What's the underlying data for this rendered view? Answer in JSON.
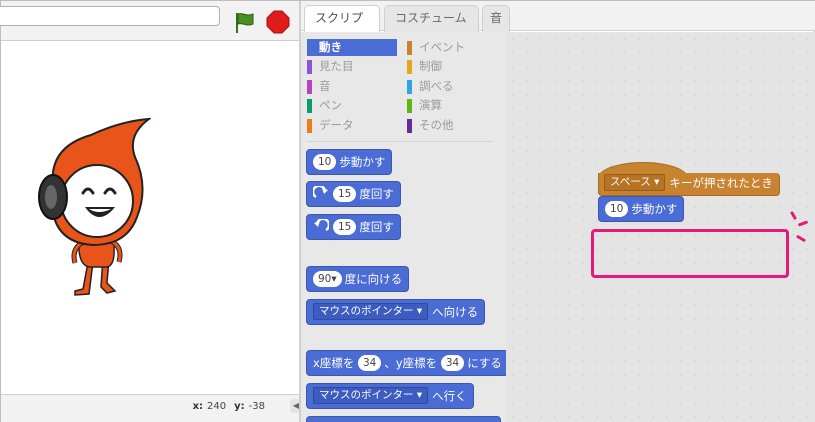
{
  "stage": {
    "coords": {
      "x_label": "x:",
      "x_value": "240",
      "y_label": "y:",
      "y_value": "-38"
    }
  },
  "tabs": [
    {
      "label": "スクリプト"
    },
    {
      "label": "コスチューム"
    },
    {
      "label": "音"
    }
  ],
  "categories": [
    {
      "label": "動き",
      "color": "#4a6cd4"
    },
    {
      "label": "イベント",
      "color": "#c88330"
    },
    {
      "label": "見た目",
      "color": "#8a55d7"
    },
    {
      "label": "制御",
      "color": "#e1a91a"
    },
    {
      "label": "音",
      "color": "#bb42c3"
    },
    {
      "label": "調べる",
      "color": "#2ca5e2"
    },
    {
      "label": "ペン",
      "color": "#0e9a6c"
    },
    {
      "label": "演算",
      "color": "#5cb712"
    },
    {
      "label": "データ",
      "color": "#ee7d16"
    },
    {
      "label": "その他",
      "color": "#632d99"
    }
  ],
  "palette": {
    "move": {
      "num": "10",
      "text": "歩動かす"
    },
    "turn_right": {
      "num": "15",
      "text": "度回す"
    },
    "turn_left": {
      "num": "15",
      "text": "度回す"
    },
    "point_dir": {
      "value": "90▾",
      "text": "度に向ける"
    },
    "point_towards": {
      "drop": "マウスのポインター ▾",
      "text": "へ向ける"
    },
    "goto_xy": {
      "x_text": "x座標を",
      "x_val": "34",
      "sep": "、y座標を",
      "y_val": "34",
      "end": "にする"
    },
    "goto": {
      "drop": "マウスのポインター ▾",
      "text": "へ行く"
    }
  },
  "script": {
    "hat": {
      "drop": "スペース ▾",
      "text": "キーが押されたとき"
    },
    "move": {
      "num": "10",
      "text": "歩動かす"
    }
  }
}
